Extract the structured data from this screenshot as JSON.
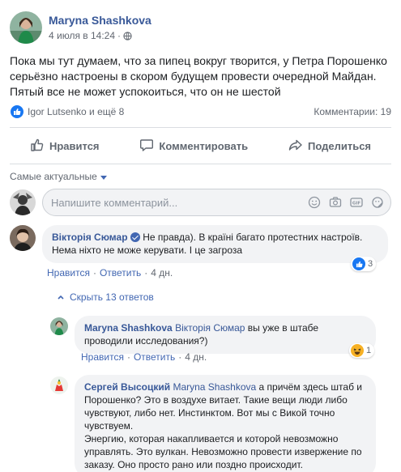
{
  "post": {
    "author": "Maryna Shashkova",
    "date": "4 июля в 14:24",
    "text": "Пока мы тут думаем, что за пипец вокруг творится, у Петра Порошенко серьёзно настроены в скором будущем провести очередной Майдан. Пятый все не может успокоиться, что он не шестой",
    "reactions_text": "Igor Lutsenko и ещё 8",
    "comments_count": "Комментарии: 19"
  },
  "actions": {
    "like": "Нравится",
    "comment": "Комментировать",
    "share": "Поделиться"
  },
  "sort_label": "Самые актуальные",
  "composer": {
    "placeholder": "Напишите комментарий..."
  },
  "comments": [
    {
      "author": "Вікторія Сюмар",
      "text": "Не правда). В країні багато протестних настроїв. Нема ніхто не може керувати. І це загроза",
      "like": "Нравится",
      "reply": "Ответить",
      "time": "4 дн.",
      "reaction_count": "3"
    }
  ],
  "hide_replies": "Скрыть 13 ответов",
  "replies": [
    {
      "author": "Maryna Shashkova",
      "mention": "Вікторія Сюмар",
      "text": "вы уже в штабе проводили исследования?)",
      "like": "Нравится",
      "reply": "Ответить",
      "time": "4 дн.",
      "reaction_count": "1"
    },
    {
      "author": "Сергей Высоцкий",
      "mention": "Maryna Shashkova",
      "text1": "а причём здесь штаб и Порошенко? Это в воздухе витает. Такие вещи люди либо чувствуют, либо нет. Инстинктом. Вот мы с Викой точно чувствуем.",
      "text2": "Энергию, которая накапливается и которой невозможно управлять. Это вулкан. Невозможно провести извержение по заказу. Оно просто рано или поздно происходит."
    }
  ],
  "colors": {
    "link": "#385898",
    "accent": "#4267b2",
    "like_blue": "#1877f2",
    "bubble": "#f2f3f5",
    "muted": "#616770"
  }
}
